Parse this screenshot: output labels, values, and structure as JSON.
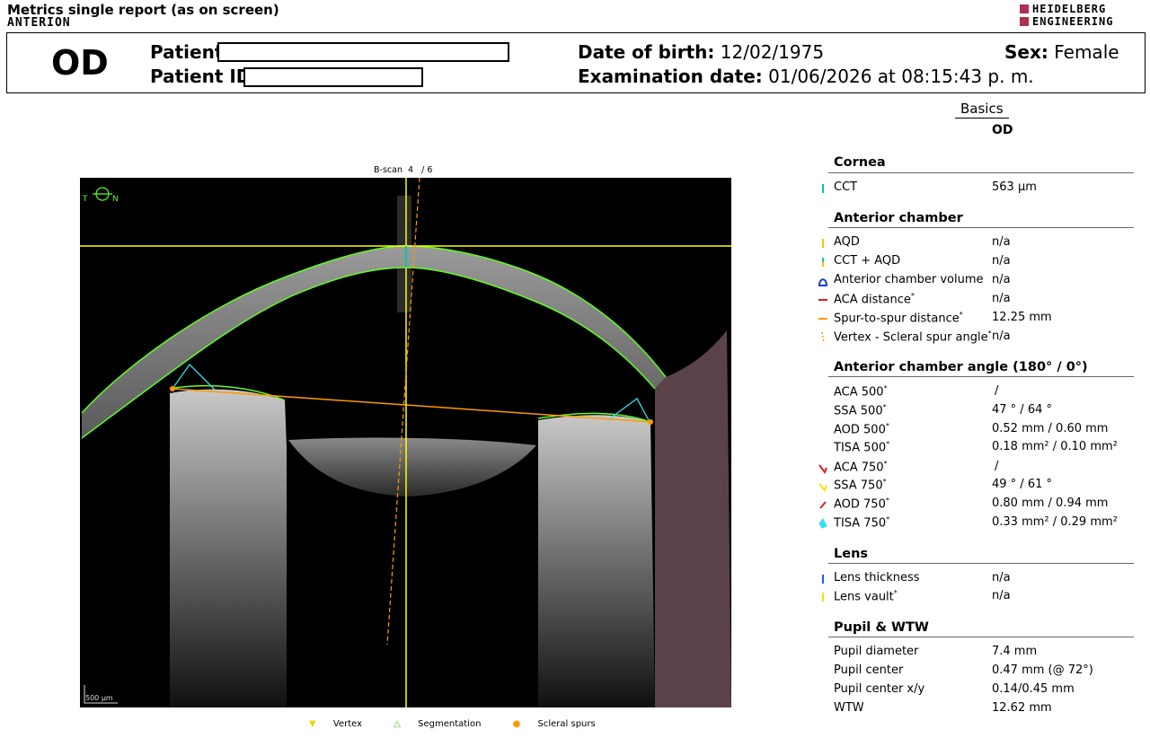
{
  "report": {
    "title": "Metrics single report (as on screen)",
    "device": "ANTERION",
    "brand_line1": "HEIDELBERG",
    "brand_line2": "ENGINEERING"
  },
  "header": {
    "eye": "OD",
    "patient_label": "Patient:",
    "patient_id_label": "Patient ID:",
    "dob_label": "Date of birth:",
    "dob_value": "12/02/1975",
    "exam_label": "Examination date:",
    "exam_value": "01/06/2026 at 08:15:43 p. m.",
    "sex_label": "Sex:",
    "sex_value": "Female"
  },
  "image": {
    "bscan_label": "B-scan",
    "bscan_index": "4",
    "bscan_total": "/ 6",
    "orientation_t": "T",
    "orientation_n": "N",
    "scale_bar": "500 µm",
    "legend": [
      "Vertex",
      "Segmentation",
      "Scleral spurs"
    ]
  },
  "panel": {
    "tab": "Basics",
    "eye": "OD",
    "sections": {
      "cornea": "Cornea",
      "anterior_chamber": "Anterior chamber",
      "ac_angle": "Anterior chamber angle (180° / 0°)",
      "lens": "Lens",
      "pupil": "Pupil & WTW"
    },
    "rows": {
      "cct": {
        "label": "CCT",
        "value": "563 µm"
      },
      "aqd": {
        "label": "AQD",
        "value": "n/a"
      },
      "cct_aqd": {
        "label": "CCT + AQD",
        "value": "n/a"
      },
      "acv": {
        "label": "Anterior chamber volume",
        "value": "n/a"
      },
      "aca_distance": {
        "label": "ACA distance",
        "value": "n/a"
      },
      "sts_distance": {
        "label": "Spur-to-spur distance",
        "value": "12.25 mm"
      },
      "vertex_spur_angle": {
        "label": "Vertex - Scleral spur angle",
        "value": "n/a"
      },
      "aca500": {
        "label": "ACA 500",
        "value": "/"
      },
      "ssa500": {
        "label": "SSA 500",
        "value": "47 ° / 64 °"
      },
      "aod500": {
        "label": "AOD 500",
        "value": "0.52 mm / 0.60 mm"
      },
      "tisa500": {
        "label": "TISA 500",
        "value": "0.18 mm² / 0.10 mm²"
      },
      "aca750": {
        "label": "ACA 750",
        "value": "/"
      },
      "ssa750": {
        "label": "SSA 750",
        "value": "49 ° / 61 °"
      },
      "aod750": {
        "label": "AOD 750",
        "value": "0.80 mm / 0.94 mm"
      },
      "tisa750": {
        "label": "TISA 750",
        "value": "0.33 mm² / 0.29 mm²"
      },
      "lens_thickness": {
        "label": "Lens thickness",
        "value": "n/a"
      },
      "lens_vault": {
        "label": "Lens vault",
        "value": "n/a"
      },
      "pupil_diameter": {
        "label": "Pupil diameter",
        "value": "7.4 mm"
      },
      "pupil_center": {
        "label": "Pupil center",
        "value": "0.47 mm (@ 72°)"
      },
      "pupil_center_xy": {
        "label": "Pupil center x/y",
        "value": "0.14/0.45 mm"
      },
      "wtw": {
        "label": "WTW",
        "value": "12.62 mm"
      }
    },
    "asterisk": "*"
  },
  "colors": {
    "cct": "#00c8a0",
    "aqd": "#ffc000",
    "acv": "#1a3fd0",
    "aca_distance": "#e02020",
    "sts": "#ff9900",
    "lens_thickness": "#1a5fe0",
    "lens_vault": "#ffe000",
    "segmentation": "#60ff20",
    "vertex": "#ffff00",
    "scan_bg": "#000000"
  }
}
